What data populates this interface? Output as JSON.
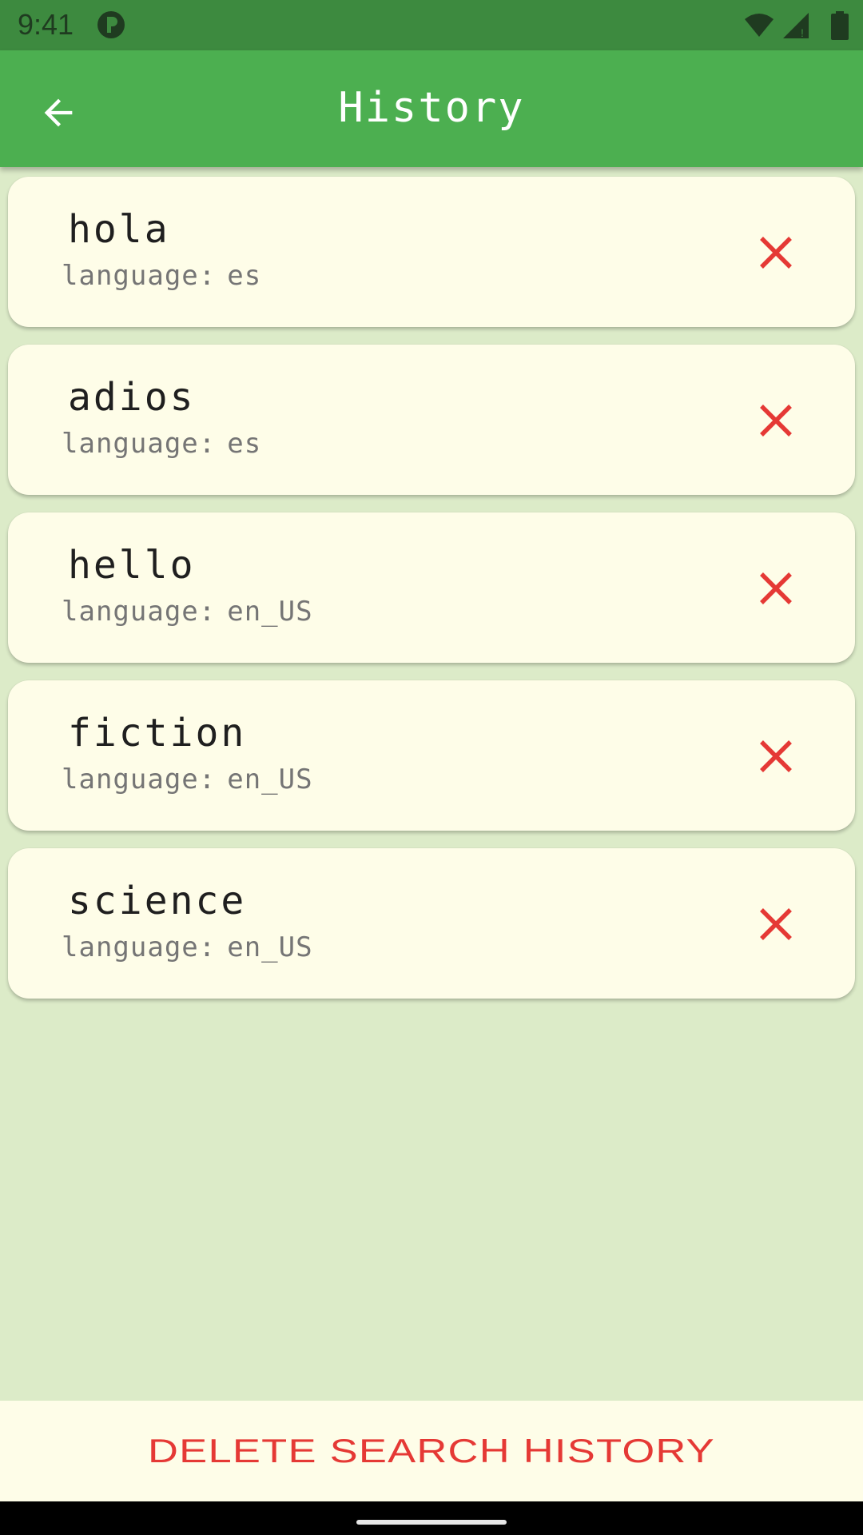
{
  "status_bar": {
    "time": "9:41",
    "icons": [
      "app-notification-icon",
      "wifi-icon",
      "cellular-signal-icon",
      "battery-icon"
    ]
  },
  "app_bar": {
    "title": "History",
    "back_icon": "arrow-back-icon"
  },
  "history": {
    "language_label": "language:",
    "items": [
      {
        "word": "hola",
        "language": "es"
      },
      {
        "word": "adios",
        "language": "es"
      },
      {
        "word": "hello",
        "language": "en_US"
      },
      {
        "word": "fiction",
        "language": "en_US"
      },
      {
        "word": "science",
        "language": "en_US"
      }
    ],
    "delete_icon": "close-icon"
  },
  "footer": {
    "delete_all_label": "DELETE SEARCH HISTORY"
  },
  "colors": {
    "status_bar": "#3d8a3f",
    "app_bar": "#4caf50",
    "background": "#dcebc8",
    "card": "#fefde8",
    "delete_red": "#e53935",
    "secondary_text": "#757575"
  }
}
